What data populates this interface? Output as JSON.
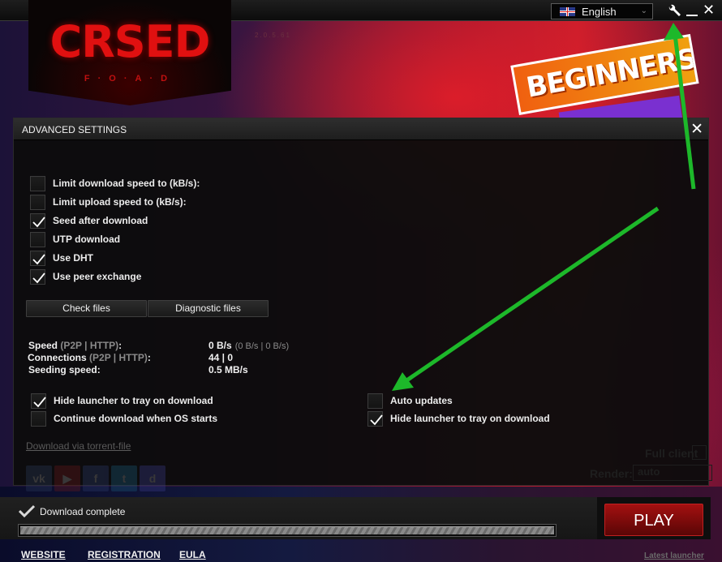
{
  "app": {
    "logo_text": "CRSED",
    "logo_subtitle": "F·O·A·D",
    "version": "2.0.5.61"
  },
  "topbar": {
    "language": "English",
    "language_flag": "uk-us-flag-icon",
    "settings_icon": "wrench-icon",
    "minimize_icon": "minimize-icon",
    "close_icon": "close-icon"
  },
  "banner": {
    "text": "BEGINNERS"
  },
  "dialog": {
    "title": "ADVANCED SETTINGS",
    "close_symbol": "✕",
    "torrent_options": [
      {
        "label": "Limit download speed to (kB/s):",
        "checked": false
      },
      {
        "label": "Limit upload speed to (kB/s):",
        "checked": false
      },
      {
        "label": "Seed after download",
        "checked": true
      },
      {
        "label": "UTP download",
        "checked": false
      },
      {
        "label": "Use DHT",
        "checked": true
      },
      {
        "label": "Use peer exchange",
        "checked": true
      }
    ],
    "buttons": {
      "check_files": "Check files",
      "diagnostic_files": "Diagnostic files"
    },
    "stats": {
      "speed_label": "Speed",
      "speed_dim": "(P2P | HTTP)",
      "speed_value": "0 B/s",
      "speed_breakdown": "(0 B/s | 0 B/s)",
      "connections_label": "Connections",
      "connections_dim": "(P2P | HTTP)",
      "connections_value": "44 | 0",
      "seeding_label": "Seeding speed:",
      "seeding_value": "0.5 MB/s",
      "colon": ":"
    },
    "launcher_options_left": [
      {
        "label": "Hide launcher to tray on download",
        "checked": true
      },
      {
        "label": "Continue download when OS starts",
        "checked": false
      }
    ],
    "launcher_options_right": [
      {
        "label": "Auto updates",
        "checked": false
      },
      {
        "label": "Hide launcher to tray on download",
        "checked": true
      }
    ],
    "torrent_link": "Download via torrent-file",
    "social": [
      "vk",
      "▶",
      "f",
      "t",
      "d"
    ]
  },
  "background_ghost": {
    "full_client": "Full client",
    "render_label": "Render:",
    "render_value": "auto"
  },
  "status": {
    "text": "Download complete",
    "progress_percent": 100
  },
  "play_button": "PLAY",
  "footer": {
    "website": "WEBSITE",
    "registration": "REGISTRATION",
    "eula": "EULA",
    "latest_launcher": "Latest launcher"
  },
  "colors": {
    "accent_red": "#a31010",
    "annotation_green": "#1db82a"
  }
}
